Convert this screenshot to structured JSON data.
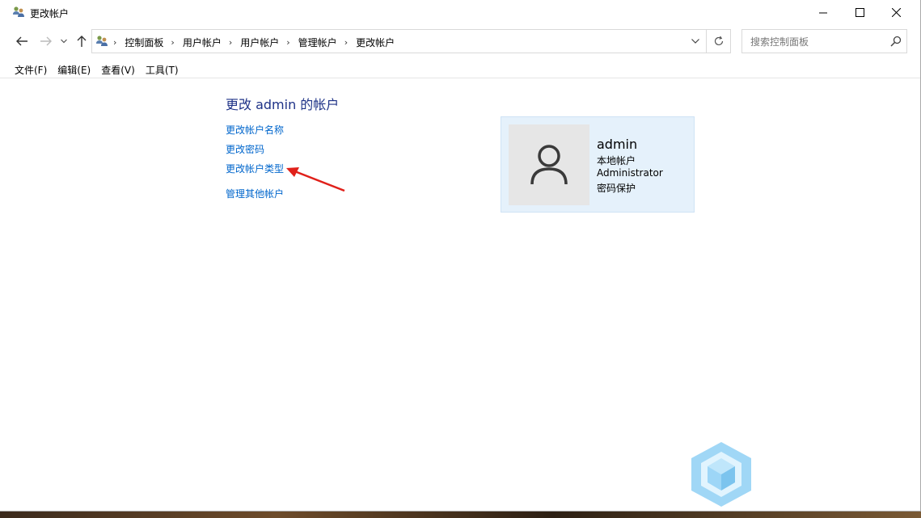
{
  "window": {
    "title": "更改帐户",
    "controls": {
      "minimize_icon": "minimize-icon",
      "maximize_icon": "maximize-icon",
      "close_icon": "close-icon"
    }
  },
  "nav": {
    "back_icon": "arrow-left-icon",
    "forward_icon": "arrow-right-icon",
    "recent_icon": "chevron-down-icon",
    "up_icon": "arrow-up-icon"
  },
  "address": {
    "breadcrumbs": [
      "控制面板",
      "用户帐户",
      "用户帐户",
      "管理帐户",
      "更改帐户"
    ],
    "separator": "›"
  },
  "search": {
    "placeholder": "搜索控制面板"
  },
  "menu": [
    "文件(F)",
    "编辑(E)",
    "查看(V)",
    "工具(T)"
  ],
  "content": {
    "heading": "更改 admin 的帐户",
    "links": [
      "更改帐户名称",
      "更改密码",
      "更改帐户类型",
      "管理其他帐户"
    ]
  },
  "account": {
    "name": "admin",
    "type_local": "本地帐户",
    "group": "Administrator",
    "status": "密码保护"
  },
  "colors": {
    "heading": "#1e3287",
    "link": "#0066cc",
    "card_bg": "#e5f1fb",
    "arrow": "#e0201a"
  }
}
